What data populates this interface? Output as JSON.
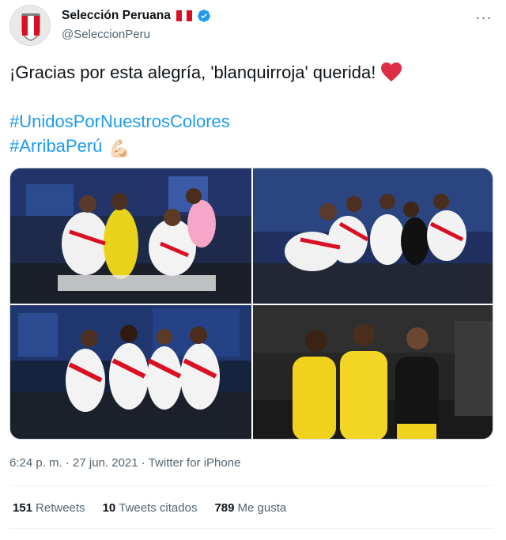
{
  "author": {
    "display_name": "Selección Peruana",
    "handle": "@SeleccionPeru",
    "verified": true,
    "flag_colors": [
      "#d91023",
      "#ffffff",
      "#d91023"
    ],
    "avatar_icon": "peru-crest-icon"
  },
  "tweet": {
    "line1": "¡Gracias por esta alegría, 'blanquirroja' querida!",
    "hashtag1": "#UnidosPorNuestrosColores",
    "hashtag2": "#ArribaPerú",
    "emoji_muscle": "💪🏻",
    "heart_icon": "red-heart-icon"
  },
  "media": {
    "count": 4,
    "photos": [
      "team-photo-1",
      "team-photo-2",
      "team-photo-3",
      "team-photo-4"
    ]
  },
  "meta": {
    "time": "6:24 p. m.",
    "separator": " · ",
    "date": "27 jun. 2021",
    "source": "Twitter for iPhone"
  },
  "stats": {
    "retweets_count": "151",
    "retweets_label": "Retweets",
    "quotes_count": "10",
    "quotes_label": "Tweets citados",
    "likes_count": "789",
    "likes_label": "Me gusta"
  },
  "colors": {
    "link": "#1d9bf0",
    "text": "#0f1419",
    "muted": "#536471",
    "verified": "#1d9bf0",
    "peru_red": "#d91023"
  }
}
